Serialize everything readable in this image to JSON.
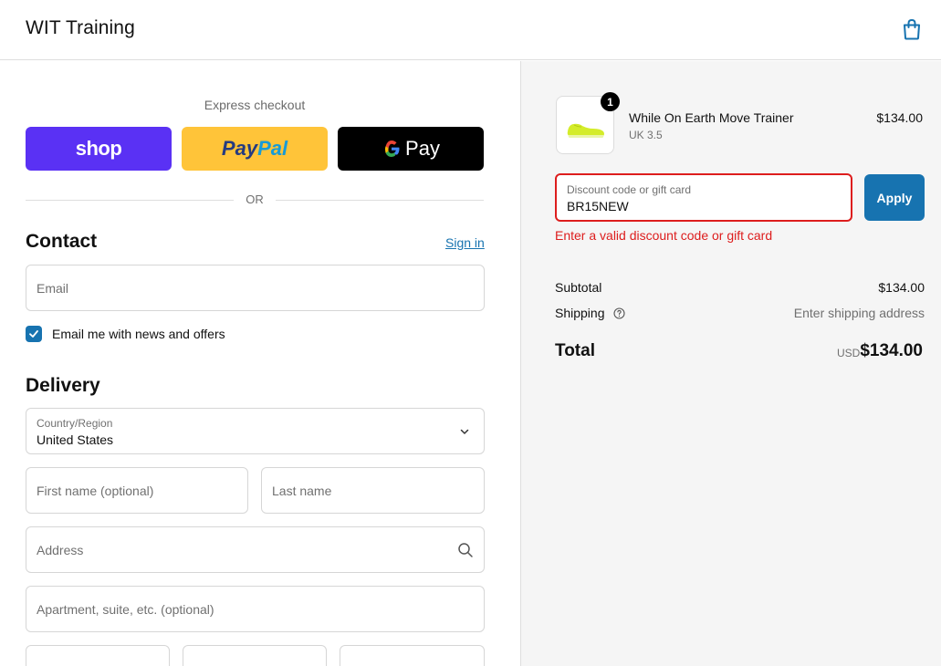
{
  "header": {
    "brand": "WIT Training",
    "cart_icon": "shopping-bag-icon"
  },
  "express": {
    "label": "Express checkout",
    "buttons": {
      "shop": "shop",
      "paypal_part1": "Pay",
      "paypal_part2": "Pal",
      "gpay_g": "G",
      "gpay_text": "Pay"
    },
    "or": "OR"
  },
  "contact": {
    "title": "Contact",
    "sign_in": "Sign in",
    "email_placeholder": "Email",
    "newsletter_label": "Email me with news and offers",
    "newsletter_checked": true
  },
  "delivery": {
    "title": "Delivery",
    "country_label": "Country/Region",
    "country_value": "United States",
    "first_name_placeholder": "First name (optional)",
    "last_name_placeholder": "Last name",
    "address_placeholder": "Address",
    "apartment_placeholder": "Apartment, suite, etc. (optional)"
  },
  "summary": {
    "product": {
      "name": "While On Earth Move Trainer",
      "variant": "UK 3.5",
      "price": "$134.00",
      "quantity": "1"
    },
    "discount": {
      "label": "Discount code or gift card",
      "value": "BR15NEW",
      "apply": "Apply",
      "error": "Enter a valid discount code or gift card"
    },
    "subtotal_label": "Subtotal",
    "subtotal_value": "$134.00",
    "shipping_label": "Shipping",
    "shipping_value": "Enter shipping address",
    "total_label": "Total",
    "currency": "USD",
    "total_value": "$134.00"
  },
  "colors": {
    "accent": "#1773b0",
    "error": "#dd1d1d",
    "shop": "#5a31f4",
    "paypal": "#ffc439"
  }
}
